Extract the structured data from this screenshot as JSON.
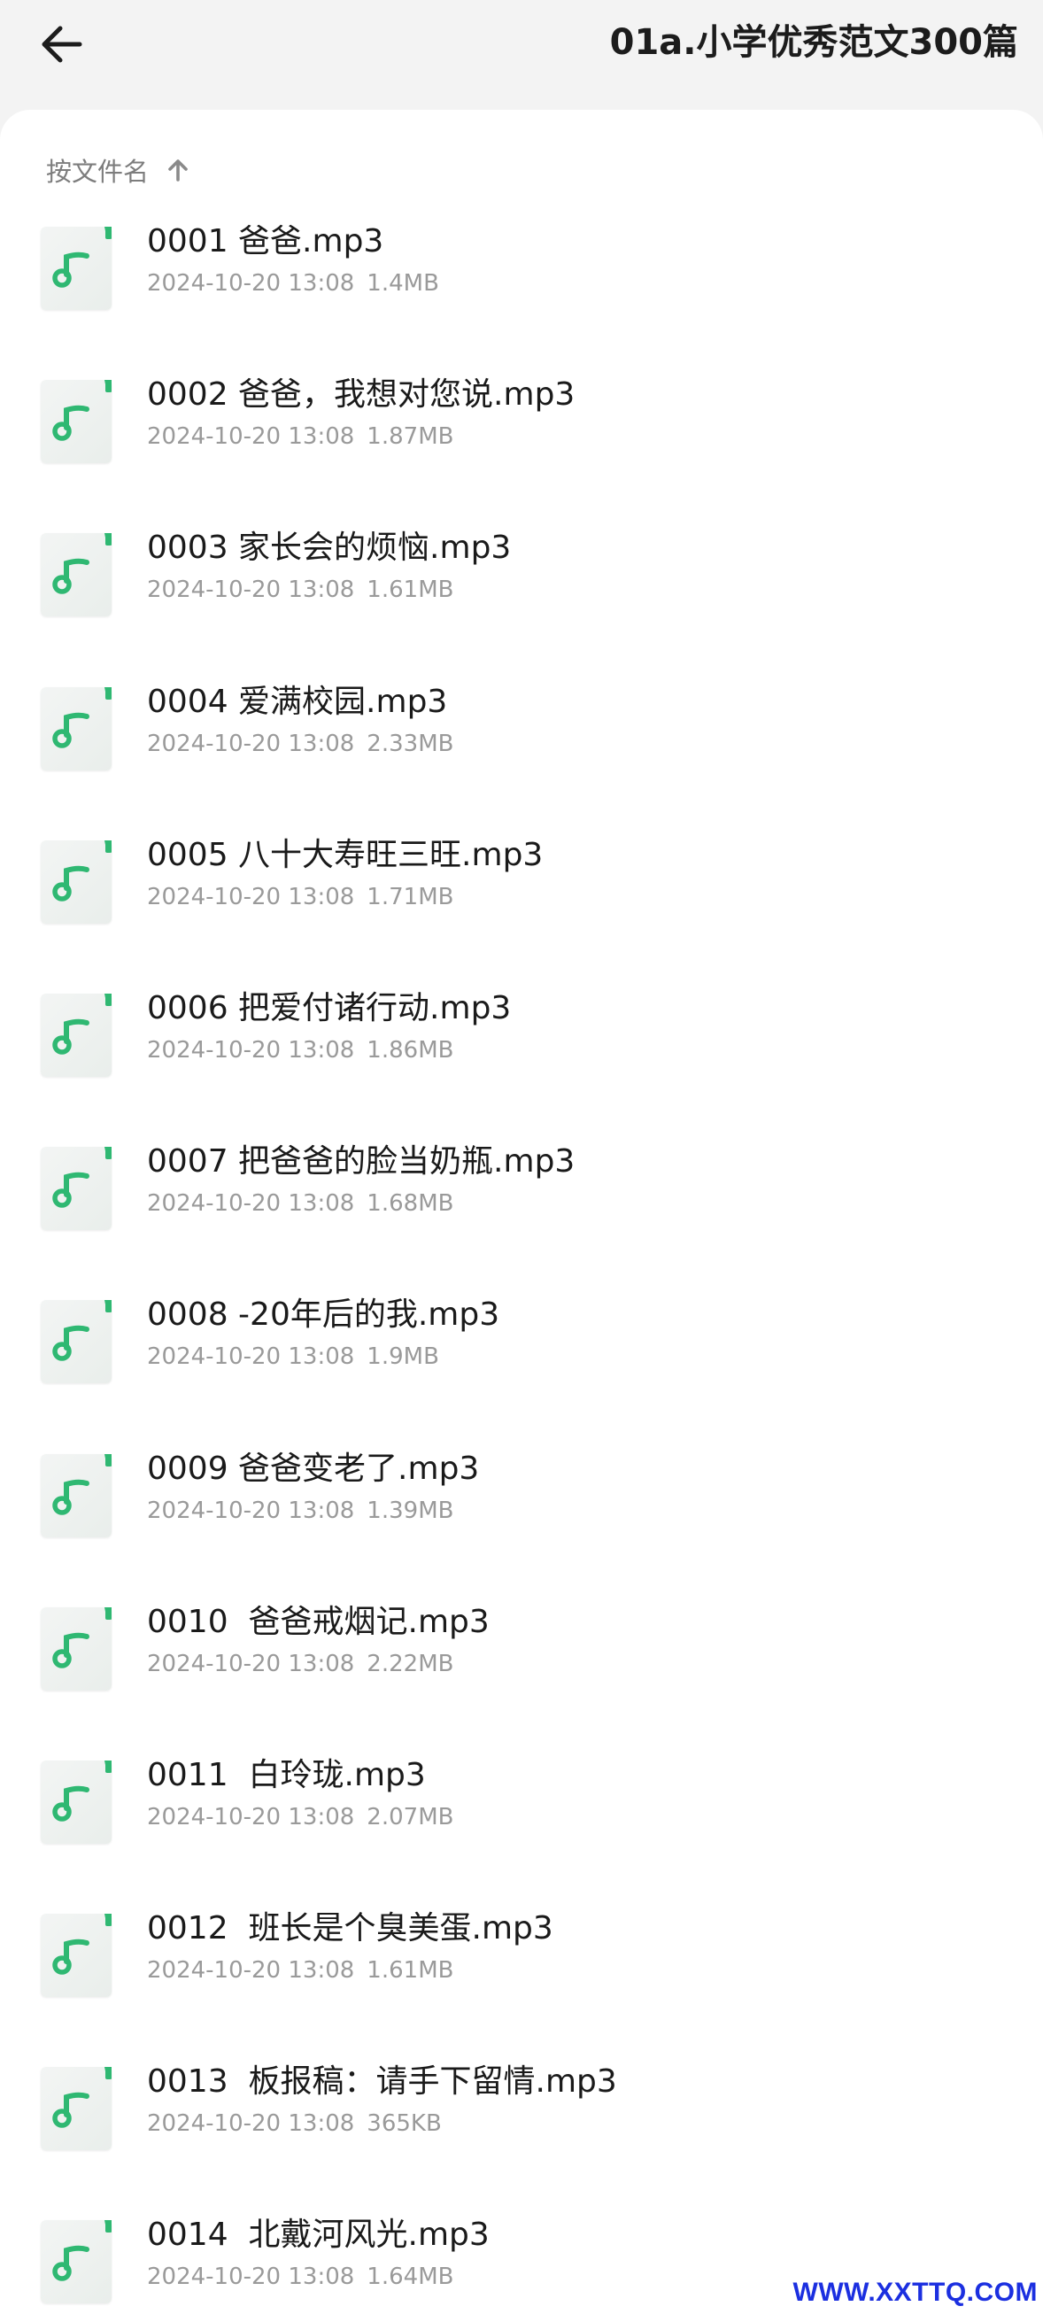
{
  "header": {
    "title": "01a.小学优秀范文300篇"
  },
  "sort": {
    "label": "按文件名"
  },
  "colors": {
    "accent": "#2fb872",
    "icon_bg": "#eef2f0",
    "watermark": "#1b2fe0"
  },
  "files": [
    {
      "name": "0001 爸爸.mp3",
      "date": "2024-10-20 13:08",
      "size": "1.4MB"
    },
    {
      "name": "0002 爸爸，我想对您说.mp3",
      "date": "2024-10-20 13:08",
      "size": "1.87MB"
    },
    {
      "name": "0003 家长会的烦恼.mp3",
      "date": "2024-10-20 13:08",
      "size": "1.61MB"
    },
    {
      "name": "0004 爱满校园.mp3",
      "date": "2024-10-20 13:08",
      "size": "2.33MB"
    },
    {
      "name": "0005 八十大寿旺三旺.mp3",
      "date": "2024-10-20 13:08",
      "size": "1.71MB"
    },
    {
      "name": "0006 把爱付诸行动.mp3",
      "date": "2024-10-20 13:08",
      "size": "1.86MB"
    },
    {
      "name": "0007 把爸爸的脸当奶瓶.mp3",
      "date": "2024-10-20 13:08",
      "size": "1.68MB"
    },
    {
      "name": "0008 -20年后的我.mp3",
      "date": "2024-10-20 13:08",
      "size": "1.9MB"
    },
    {
      "name": "0009 爸爸变老了.mp3",
      "date": "2024-10-20 13:08",
      "size": "1.39MB"
    },
    {
      "name": "0010  爸爸戒烟记.mp3",
      "date": "2024-10-20 13:08",
      "size": "2.22MB"
    },
    {
      "name": "0011  白玲珑.mp3",
      "date": "2024-10-20 13:08",
      "size": "2.07MB"
    },
    {
      "name": "0012  班长是个臭美蛋.mp3",
      "date": "2024-10-20 13:08",
      "size": "1.61MB"
    },
    {
      "name": "0013  板报稿：请手下留情.mp3",
      "date": "2024-10-20 13:08",
      "size": "365KB"
    },
    {
      "name": "0014  北戴河风光.mp3",
      "date": "2024-10-20 13:08",
      "size": "1.64MB"
    }
  ],
  "icons": {
    "back": "arrow-left-icon",
    "sort": "arrow-up-icon",
    "file": "music-note-icon"
  },
  "watermark": "WWW.XXTTQ.COM"
}
